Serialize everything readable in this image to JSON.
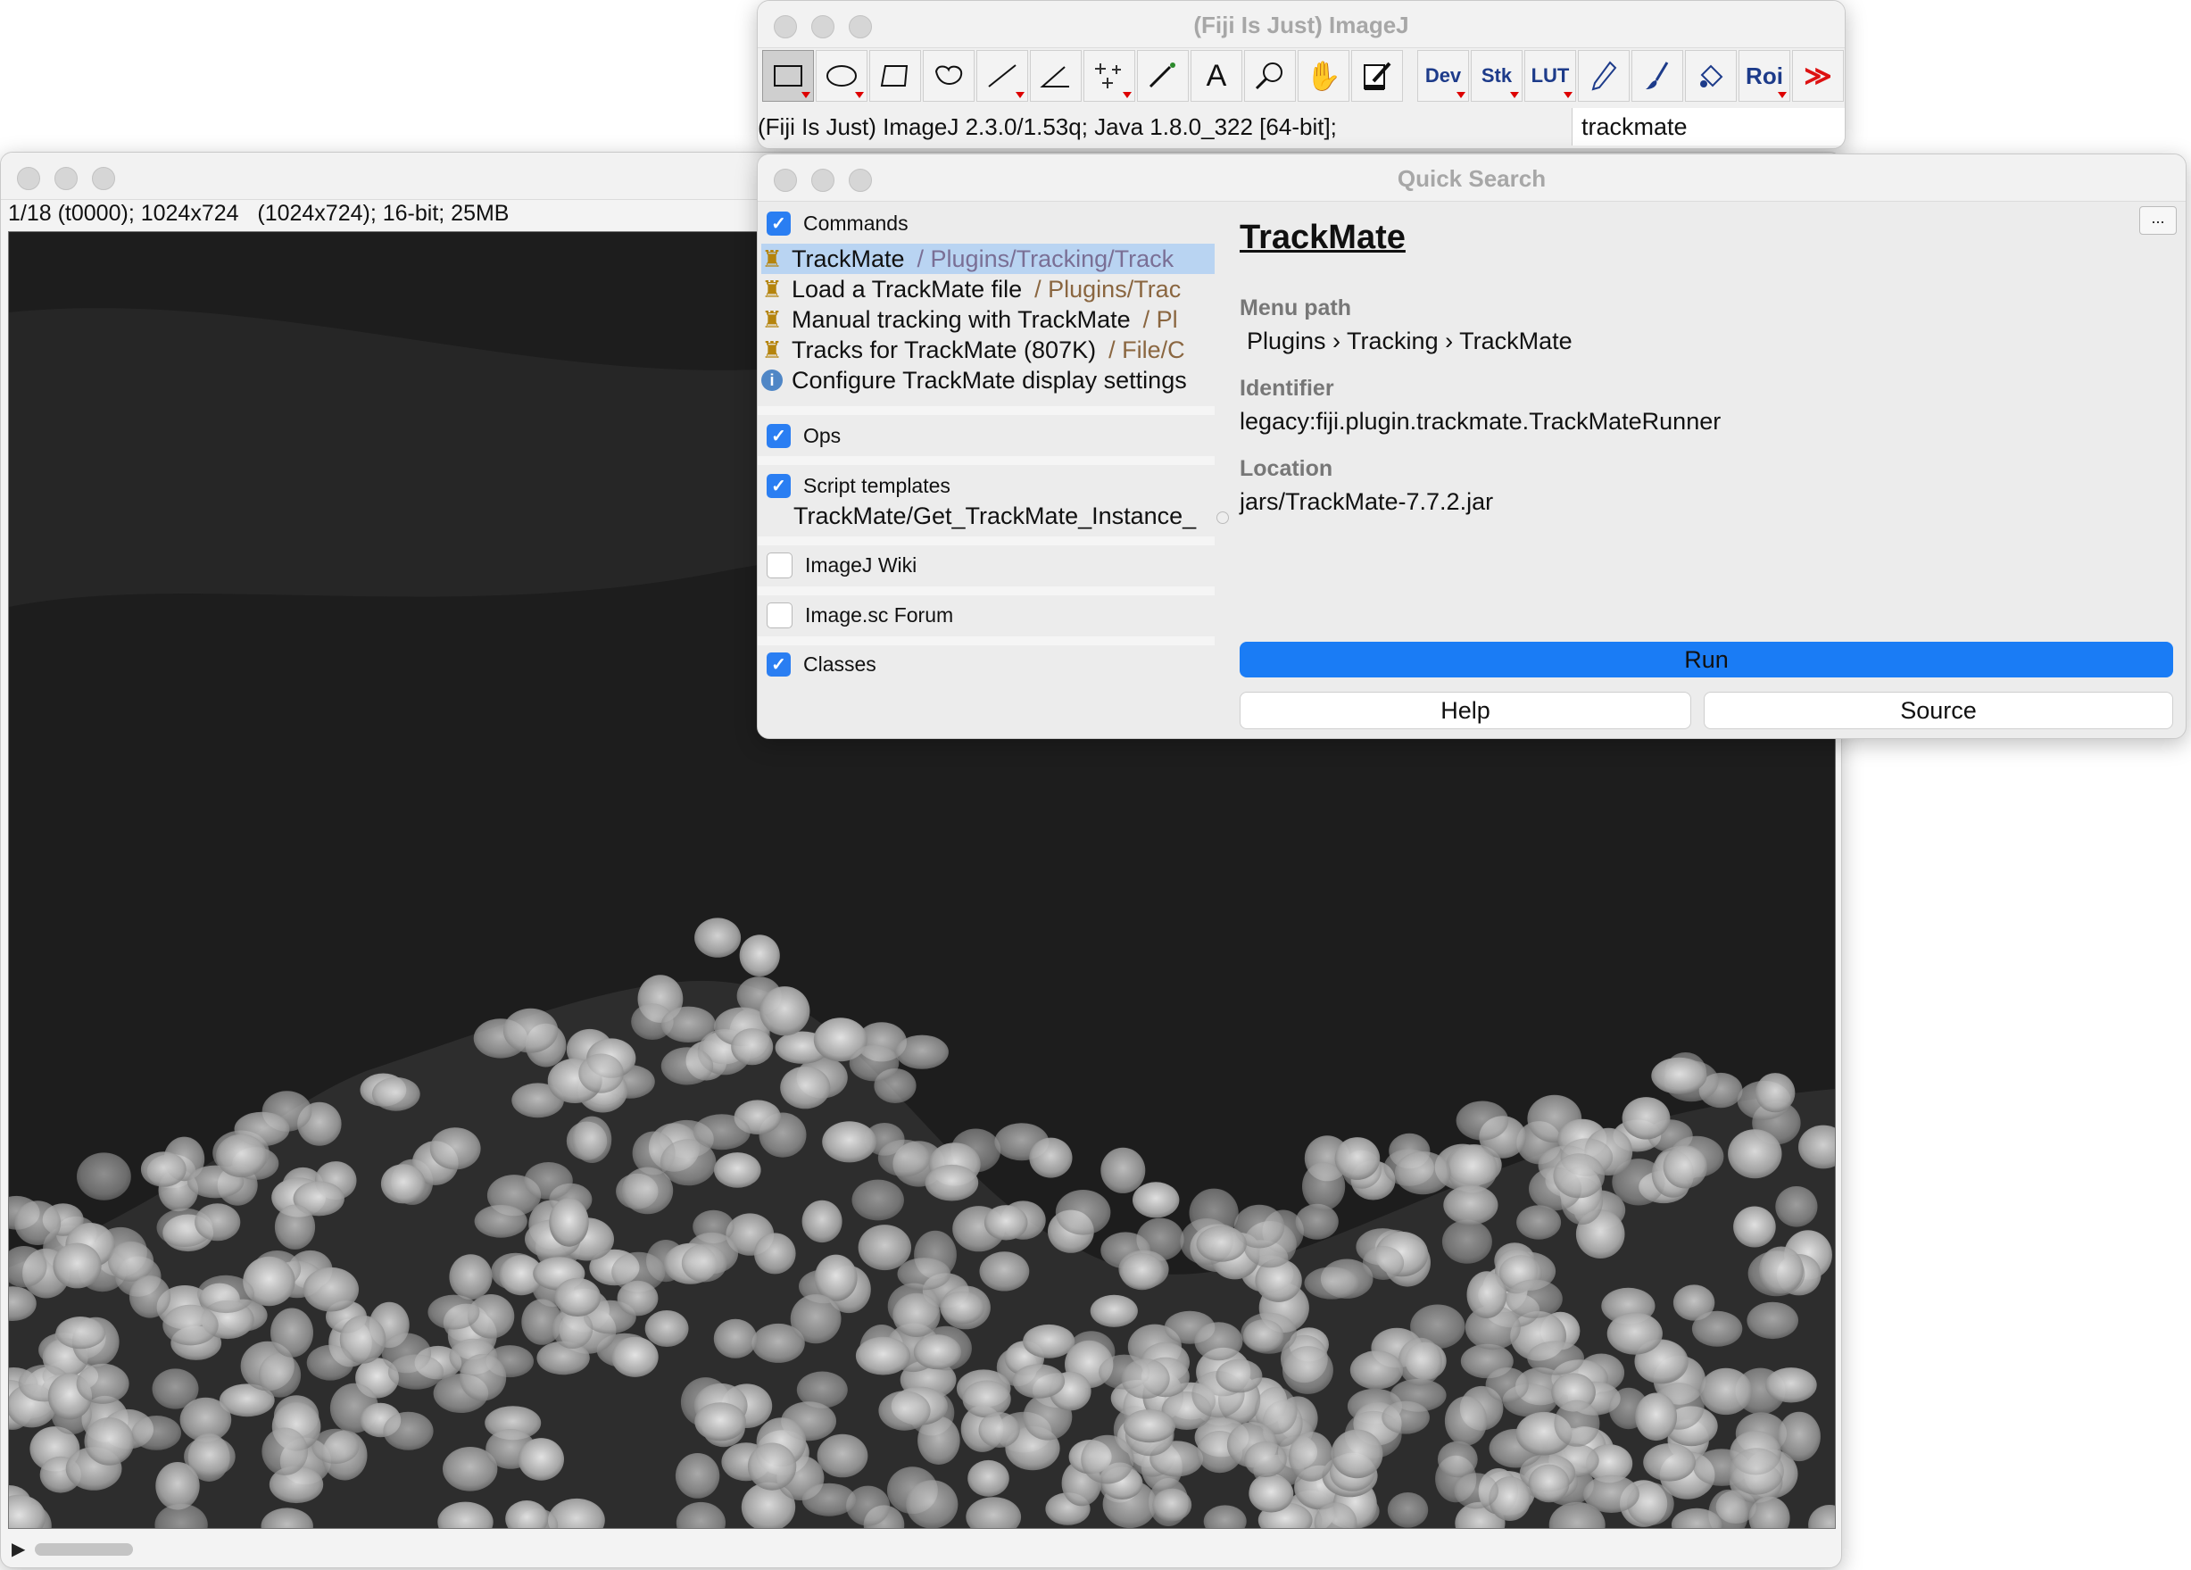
{
  "image_window": {
    "info": "1/18 (t0000); 1024x724   (1024x724); 16-bit; 25MB"
  },
  "imagej_window": {
    "title": "(Fiji Is Just) ImageJ",
    "status": "(Fiji Is Just) ImageJ 2.3.0/1.53q; Java 1.8.0_322 [64-bit];",
    "search_value": "trackmate",
    "tools": [
      {
        "name": "rectangle-tool",
        "icon": "rectangle-icon"
      },
      {
        "name": "oval-tool",
        "icon": "oval-icon"
      },
      {
        "name": "polygon-tool",
        "icon": "polygon-icon"
      },
      {
        "name": "freehand-tool",
        "icon": "freehand-icon"
      },
      {
        "name": "line-tool",
        "icon": "line-icon"
      },
      {
        "name": "angle-tool",
        "icon": "angle-icon"
      },
      {
        "name": "point-tool",
        "icon": "point-icon"
      },
      {
        "name": "wand-tool",
        "icon": "wand-icon"
      },
      {
        "name": "text-tool",
        "icon": "text-icon"
      },
      {
        "name": "magnifier-tool",
        "icon": "magnifier-icon"
      },
      {
        "name": "hand-tool",
        "icon": "hand-icon"
      },
      {
        "name": "dropper-tool",
        "icon": "dropper-icon"
      }
    ],
    "tool_labels": {
      "dev": "Dev",
      "stk": "Stk",
      "lut": "LUT",
      "roi": "Roi"
    }
  },
  "quick_search": {
    "title": "Quick Search",
    "sections": {
      "commands": "Commands",
      "ops": "Ops",
      "script_templates": "Script templates",
      "imagej_wiki": "ImageJ Wiki",
      "imagesc_forum": "Image.sc Forum",
      "classes": "Classes"
    },
    "commands": [
      {
        "name": "TrackMate",
        "path": "/ Plugins/Tracking/Track"
      },
      {
        "name": "Load a TrackMate file",
        "path": "/ Plugins/Trac"
      },
      {
        "name": "Manual tracking with TrackMate",
        "path": "/ Pl"
      },
      {
        "name": "Tracks for TrackMate (807K)",
        "path": "/ File/C"
      },
      {
        "name": "Configure TrackMate display settings",
        "path": ""
      }
    ],
    "script_template_item": "TrackMate/Get_TrackMate_Instance_",
    "detail": {
      "title": "TrackMate",
      "menu_path_label": "Menu path",
      "menu_path": "Plugins › Tracking › TrackMate",
      "identifier_label": "Identifier",
      "identifier": "legacy:fiji.plugin.trackmate.TrackMateRunner",
      "location_label": "Location",
      "location": "jars/TrackMate-7.7.2.jar",
      "more": "..."
    },
    "buttons": {
      "run": "Run",
      "help": "Help",
      "source": "Source"
    }
  },
  "colors": {
    "accent": "#1a7cf5",
    "selection": "#b9d4f2",
    "checkbox": "#2a7ef2"
  }
}
